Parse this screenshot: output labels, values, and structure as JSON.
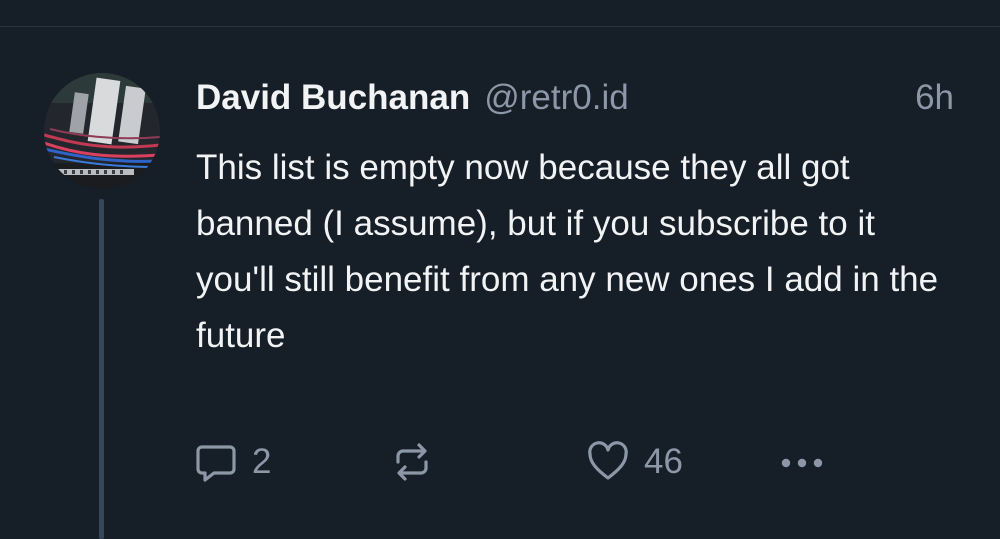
{
  "post": {
    "author_name": "David Buchanan",
    "handle": "@retr0.id",
    "timestamp": "6h",
    "text": "This list is empty now because they all got banned (I assume), but if you subscribe to it you'll still benefit from any new ones I add in the future",
    "avatar_icon": "circuit-board-avatar"
  },
  "actions": {
    "reply": {
      "icon": "speech-bubble-icon",
      "count": "2"
    },
    "repost": {
      "icon": "repost-arrows-icon",
      "count": ""
    },
    "like": {
      "icon": "heart-icon",
      "count": "46"
    },
    "more": {
      "icon": "ellipsis-icon"
    }
  },
  "colors": {
    "background": "#161e27",
    "text": "#f1f3f5",
    "muted": "#8c98a7",
    "thread_line": "#37465a"
  }
}
